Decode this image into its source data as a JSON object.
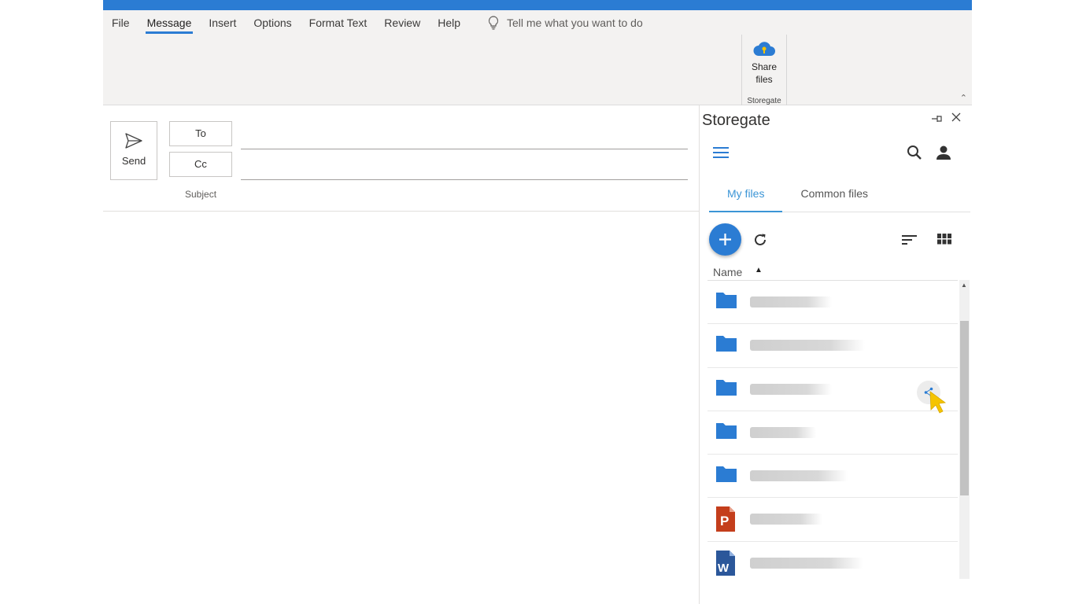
{
  "menu": {
    "items": [
      "File",
      "Message",
      "Insert",
      "Options",
      "Format Text",
      "Review",
      "Help"
    ],
    "active": "Message",
    "tell_me": "Tell me what you want to do"
  },
  "ribbon": {
    "share_label_line1": "Share",
    "share_label_line2": "files",
    "group_label": "Storegate"
  },
  "compose": {
    "send_label": "Send",
    "to_label": "To",
    "cc_label": "Cc",
    "subject_placeholder": "Subject"
  },
  "pane": {
    "title": "Storegate",
    "tabs": [
      "My files",
      "Common files"
    ],
    "active_tab": "My files",
    "column_header": "Name",
    "rows": [
      {
        "type": "folder"
      },
      {
        "type": "folder"
      },
      {
        "type": "folder",
        "shared": true
      },
      {
        "type": "folder"
      },
      {
        "type": "folder"
      },
      {
        "type": "powerpoint"
      },
      {
        "type": "word"
      }
    ]
  },
  "colors": {
    "accent": "#2b7cd3",
    "tab_active": "#3b95d6",
    "folder": "#2b7cd3",
    "powerpoint": "#c43e1c",
    "word": "#2b579a",
    "cursor": "#f5c400"
  }
}
